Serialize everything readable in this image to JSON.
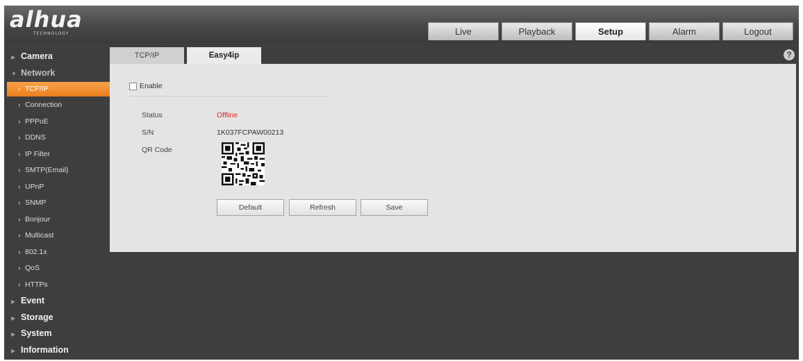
{
  "brand": {
    "logo": "alhua",
    "tagline": "TECHNOLOGY"
  },
  "top_nav": [
    {
      "label": "Live",
      "active": false
    },
    {
      "label": "Playback",
      "active": false
    },
    {
      "label": "Setup",
      "active": true
    },
    {
      "label": "Alarm",
      "active": false
    },
    {
      "label": "Logout",
      "active": false
    }
  ],
  "sidebar": {
    "camera": "Camera",
    "network": "Network",
    "network_items": [
      "TCP/IP",
      "Connection",
      "PPPoE",
      "DDNS",
      "IP Filter",
      "SMTP(Email)",
      "UPnP",
      "SNMP",
      "Bonjour",
      "Multicast",
      "802.1x",
      "QoS",
      "HTTPs"
    ],
    "selected_item": "TCP/IP",
    "event": "Event",
    "storage": "Storage",
    "system": "System",
    "information": "Information"
  },
  "content_tabs": [
    {
      "label": "TCP/IP",
      "active": false
    },
    {
      "label": "Easy4ip",
      "active": true
    }
  ],
  "help": "?",
  "form": {
    "enable_label": "Enable",
    "enable_checked": false,
    "status_label": "Status",
    "status_value": "Offline",
    "sn_label": "S/N",
    "sn_value": "1K037FCPAW00213",
    "qr_label": "QR Code"
  },
  "buttons": {
    "default": "Default",
    "refresh": "Refresh",
    "save": "Save"
  },
  "colors": {
    "accent_orange": "#ea7d1d",
    "status_offline": "#d9261c",
    "background": "#3e3e3e",
    "panel": "#e4e4e4"
  }
}
